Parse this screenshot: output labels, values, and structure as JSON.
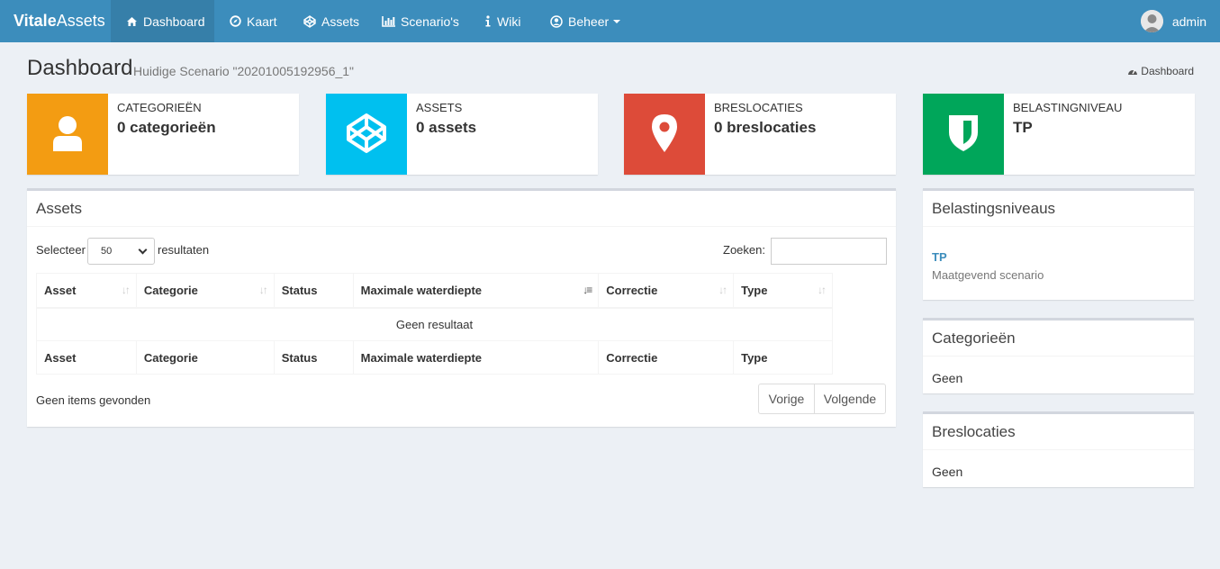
{
  "brand": {
    "bold": "Vitale",
    "normal": "Assets"
  },
  "nav": {
    "items": [
      {
        "label": "Dashboard",
        "icon": "dashboard-icon"
      },
      {
        "label": "Kaart",
        "icon": "compass-icon"
      },
      {
        "label": "Assets",
        "icon": "codepen-icon"
      },
      {
        "label": "Scenario's",
        "icon": "bar-chart-icon"
      },
      {
        "label": "Wiki",
        "icon": "info-icon"
      },
      {
        "label": "Beheer",
        "icon": "user-circle-icon"
      }
    ],
    "user": "admin"
  },
  "header": {
    "title": "Dashboard",
    "subtitle": "Huidige Scenario \"20201005192956_1\"",
    "breadcrumb": "Dashboard"
  },
  "info_boxes": [
    {
      "label": "CATEGORIEËN",
      "value": "0 categorieën",
      "color": "#f39c12",
      "icon": "user-icon"
    },
    {
      "label": "ASSETS",
      "value": "0 assets",
      "color": "#00c0ef",
      "icon": "codepen-icon"
    },
    {
      "label": "BRESLOCATIES",
      "value": "0 breslocaties",
      "color": "#dd4b39",
      "icon": "map-marker-icon"
    },
    {
      "label": "BELASTINGNIVEAU",
      "value": "TP",
      "color": "#00a65a",
      "icon": "shield-icon"
    }
  ],
  "assets_box": {
    "title": "Assets",
    "select_prefix": "Selecteer",
    "select_value": "50",
    "select_suffix": "resultaten",
    "search_label": "Zoeken:",
    "columns": [
      "Asset",
      "Categorie",
      "Status",
      "Maximale waterdiepte",
      "Correctie",
      "Type"
    ],
    "empty_text": "Geen resultaat",
    "info_text": "Geen items gevonden",
    "prev_label": "Vorige",
    "next_label": "Volgende"
  },
  "side": {
    "belasting": {
      "title": "Belastingsniveaus",
      "link": "TP",
      "desc": "Maatgevend scenario"
    },
    "categorieen": {
      "title": "Categorieën",
      "text": "Geen"
    },
    "breslocaties": {
      "title": "Breslocaties",
      "text": "Geen"
    }
  }
}
